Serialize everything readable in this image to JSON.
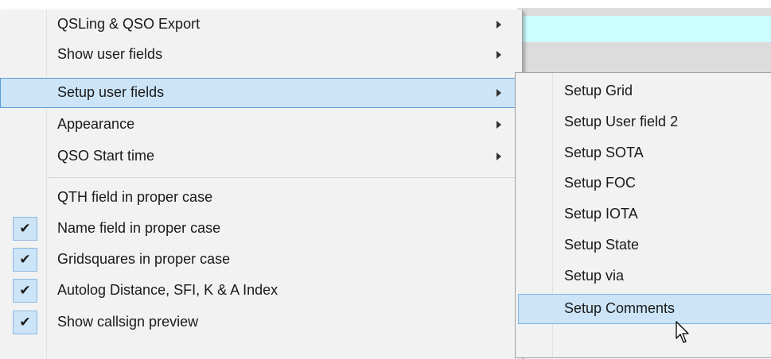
{
  "menu": {
    "items": [
      {
        "label": "QSLing & QSO Export",
        "has_submenu": true,
        "checked": false,
        "highlighted": false
      },
      {
        "label": "Show user fields",
        "has_submenu": true,
        "checked": false,
        "highlighted": false
      },
      {
        "label": "Setup user fields",
        "has_submenu": true,
        "checked": false,
        "highlighted": true
      },
      {
        "label": "Appearance",
        "has_submenu": true,
        "checked": false,
        "highlighted": false
      },
      {
        "label": "QSO Start time",
        "has_submenu": true,
        "checked": false,
        "highlighted": false
      },
      {
        "label": "QTH field in proper case",
        "has_submenu": false,
        "checked": false,
        "highlighted": false
      },
      {
        "label": "Name field in proper case",
        "has_submenu": false,
        "checked": true,
        "highlighted": false
      },
      {
        "label": "Gridsquares in proper case",
        "has_submenu": false,
        "checked": true,
        "highlighted": false
      },
      {
        "label": "Autolog Distance, SFI, K & A Index",
        "has_submenu": false,
        "checked": true,
        "highlighted": false
      },
      {
        "label": "Show callsign preview",
        "has_submenu": false,
        "checked": true,
        "highlighted": false
      }
    ],
    "check_glyph": "✔",
    "arrow_icon": "submenu-arrow-icon"
  },
  "submenu": {
    "items": [
      {
        "label": "Setup Grid",
        "highlighted": false
      },
      {
        "label": "Setup User field 2",
        "highlighted": false
      },
      {
        "label": "Setup SOTA",
        "highlighted": false
      },
      {
        "label": "Setup FOC",
        "highlighted": false
      },
      {
        "label": "Setup IOTA",
        "highlighted": false
      },
      {
        "label": "Setup State",
        "highlighted": false
      },
      {
        "label": "Setup via",
        "highlighted": false
      },
      {
        "label": "Setup Comments",
        "highlighted": true
      }
    ]
  },
  "colors": {
    "menu_bg": "#f2f2f2",
    "highlight_bg": "#cce4f7",
    "highlight_border": "#5b9bd5",
    "background_cyan_row": "#ccffff",
    "background_grey_row": "#dcdcdc"
  }
}
